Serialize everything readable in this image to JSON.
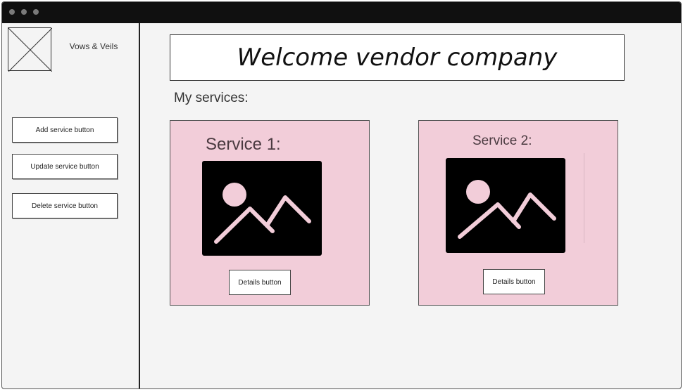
{
  "brand": {
    "name": "Vows & Veils",
    "logo_icon": "image-placeholder-icon"
  },
  "sidebar": {
    "buttons": [
      {
        "label": "Add service button"
      },
      {
        "label": "Update service button"
      },
      {
        "label": "Delete service button"
      }
    ]
  },
  "header": {
    "welcome": "Welcome vendor company"
  },
  "main": {
    "section_title": "My services:",
    "services": [
      {
        "title": "Service 1:",
        "image_icon": "image-icon",
        "button_label": "Details button"
      },
      {
        "title": "Service 2:",
        "image_icon": "image-icon",
        "button_label": "Details button"
      }
    ]
  },
  "colors": {
    "titlebar": "#101010",
    "background": "#f4f4f4",
    "card": "#f2cdd9",
    "image_bg": "#000000",
    "image_icon": "#f2cdd9"
  }
}
